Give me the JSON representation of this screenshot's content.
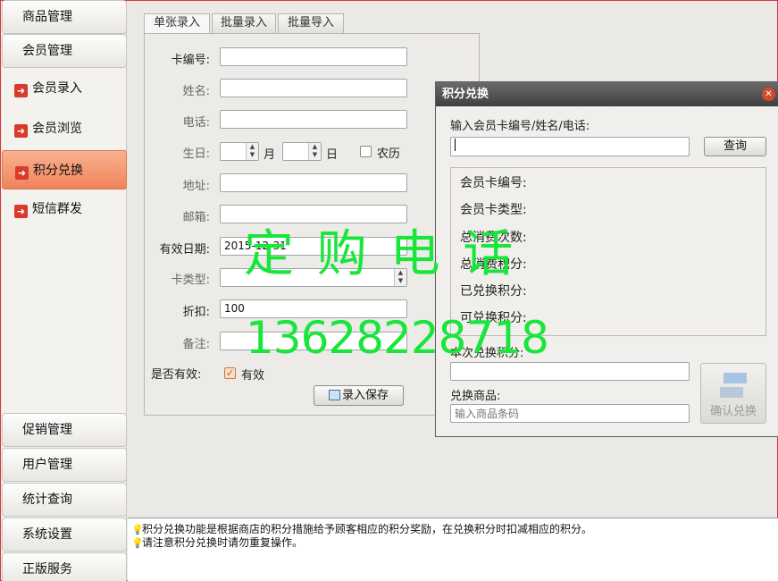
{
  "sidebar": {
    "top_groups": [
      "商品管理",
      "会员管理"
    ],
    "items": [
      {
        "label": "会员录入",
        "active": false
      },
      {
        "label": "会员浏览",
        "active": false
      },
      {
        "label": "积分兑换",
        "active": true
      },
      {
        "label": "短信群发",
        "active": false
      }
    ],
    "bottom_groups": [
      "促销管理",
      "用户管理",
      "统计查询",
      "系统设置",
      "正版服务"
    ]
  },
  "tabs": [
    "单张录入",
    "批量录入",
    "批量导入"
  ],
  "form": {
    "card_no_label": "卡编号:",
    "name_label": "姓名:",
    "phone_label": "电话:",
    "birthday_label": "生日:",
    "month_label": "月",
    "day_label": "日",
    "lunar_label": "农历",
    "address_label": "地址:",
    "email_label": "邮箱:",
    "expiry_label": "有效日期:",
    "expiry_value": "2015-12-31",
    "card_type_label": "卡类型:",
    "discount_label": "折扣:",
    "discount_value": "100",
    "note_label": "备注:",
    "valid_label": "是否有效:",
    "valid_checkbox_label": "有效",
    "valid_checked": true,
    "save_label": "录入保存"
  },
  "dialog": {
    "title": "积分兑换",
    "search_prompt": "输入会员卡编号/姓名/电话:",
    "query_label": "查询",
    "info": {
      "card_no": "会员卡编号:",
      "card_type": "会员卡类型:",
      "total_count": "总消费次数:",
      "total_points": "总消费积分:",
      "redeemed": "已兑换积分:",
      "redeemable": "可兑换积分:"
    },
    "this_redeem_label": "本次兑换积分:",
    "product_label": "兑换商品:",
    "product_placeholder": "输入商品条码",
    "confirm_label": "确认兑换"
  },
  "watermark": {
    "line1": "定 购 电 话",
    "line2": "13628228718"
  },
  "status": {
    "tips": [
      "积分兑换功能是根据商店的积分措施给予顾客相应的积分奖励，在兑换积分时扣减相应的积分。",
      "请注意积分兑换时请勿重复操作。"
    ]
  },
  "colors": {
    "active_item": "#f0835c",
    "watermark": "#19e53b",
    "frame_border": "#d23a3a"
  }
}
